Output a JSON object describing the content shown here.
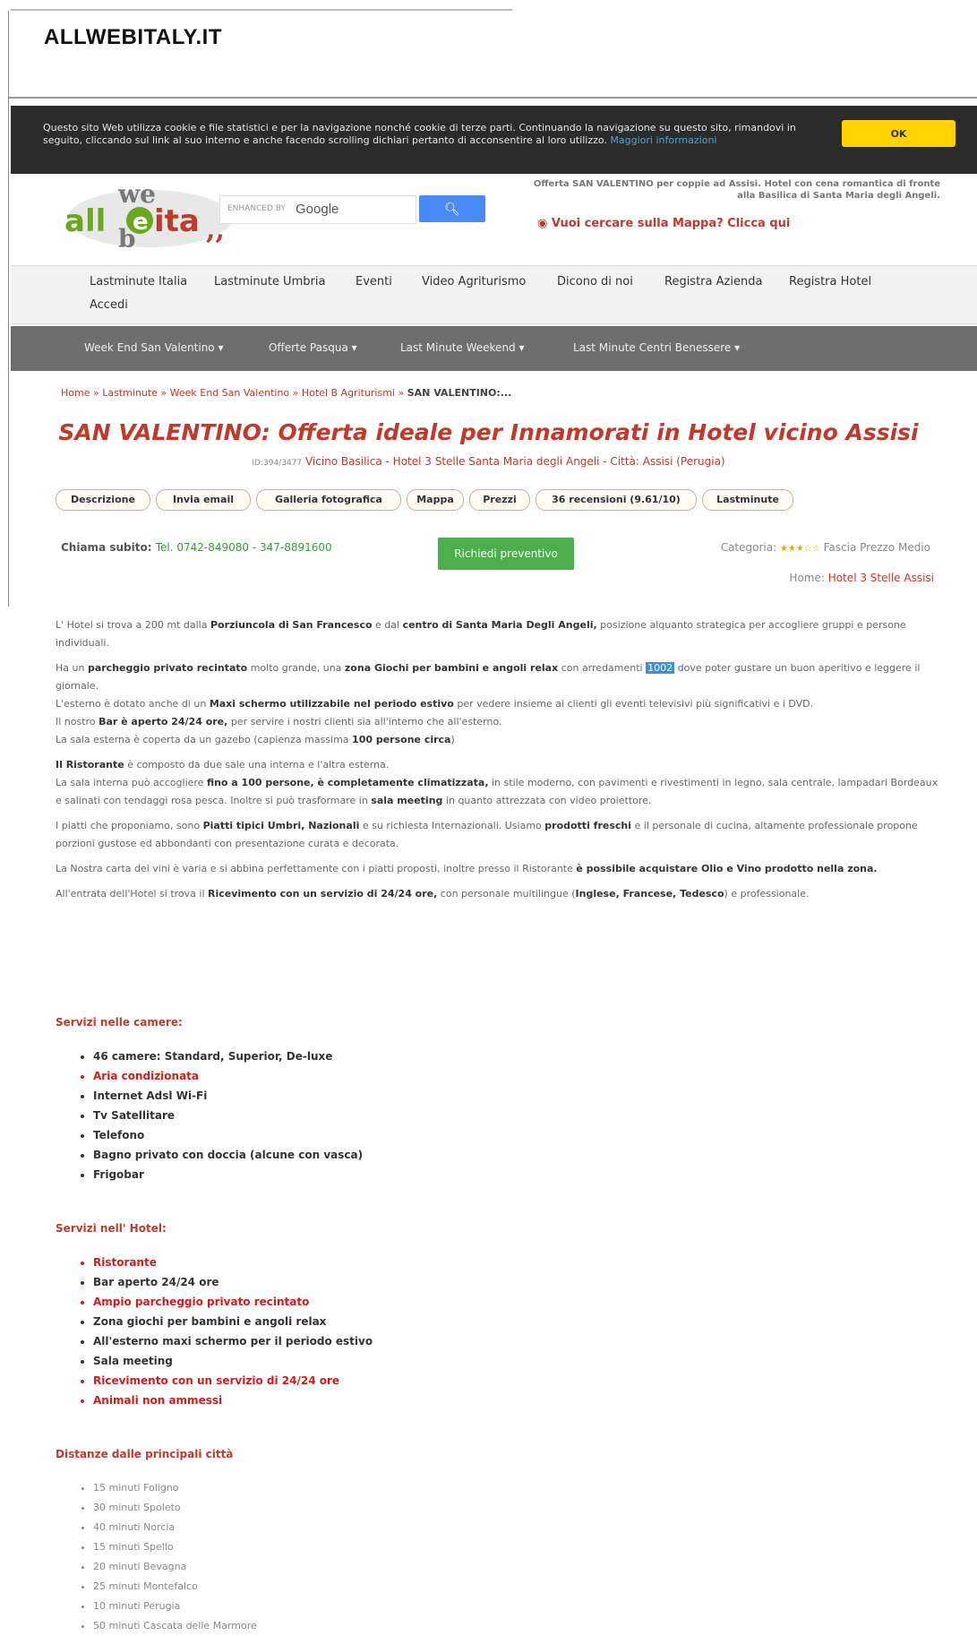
{
  "site": {
    "title": "ALLWEBITALY.IT"
  },
  "cookie": {
    "message": "Questo sito Web utilizza cookie e file statistici e per la navigazione nonché cookie di terze parti. Continuando la navigazione su questo sito, rimandovi in seguito, cliccando sul link al suo interno e anche facendo scrolling dichiari pertanto di acconsentire al loro utilizzo.",
    "link": "Maggiori informazioni",
    "ok_label": "OK"
  },
  "logo": {
    "text": "allweita"
  },
  "search": {
    "label": "ENHANCED BY",
    "brand": "Google",
    "icon": "search-icon"
  },
  "promo": "Offerta SAN VALENTINO per coppie ad Assisi. Hotel con cena romantica di fronte alla Basilica di Santa Maria degli Angeli.",
  "map_link": "Vuoi cercare sulla Mappa? Clicca qui",
  "nav_top": [
    "Lastminute Italia",
    "Lastminute Umbria",
    "Eventi",
    "Video Agriturismo",
    "Dicono di noi",
    "Registra Azienda",
    "Registra Hotel",
    "Accedi"
  ],
  "nav_bottom": [
    "Week End San Valentino ▾",
    "Offerte Pasqua ▾",
    "Last Minute Weekend ▾",
    "Last Minute Centri Benessere ▾"
  ],
  "breadcrumb": {
    "items": "Home » Lastminute » Week End San Valentino » Hotel B Agriturismi » ",
    "current": "SAN VALENTINO:..."
  },
  "heading": "SAN VALENTINO: Offerta ideale per Innamorati in Hotel vicino Assisi",
  "subline": {
    "id": "ID:394/3477",
    "text": "Vicino Basilica - Hotel 3 Stelle Santa Maria degli Angeli - Città: Assisi (Perugia)"
  },
  "tabs": [
    "Descrizione",
    "Invia email",
    "Galleria fotografica",
    "Mappa",
    "Prezzi",
    "36 recensioni (9.61/10)",
    "Lastminute"
  ],
  "contact": {
    "label": "Chiama subito:",
    "phone": "Tel. 0742-849080 - 347-8891600"
  },
  "quote_button": "Richiedi preventivo",
  "category": {
    "label": "Categoria:",
    "stars": "★★★☆☆",
    "band": "Fascia Prezzo Medio"
  },
  "home_link": {
    "label": "Home:",
    "link": "Hotel 3 Stelle Assisi"
  },
  "description": {
    "p1a": "L' Hotel si trova a 200 mt dalla ",
    "p1b": "Porziuncola di San Francesco",
    "p1c": " e dal ",
    "p1d": "centro di Santa Maria Degli Angeli,",
    "p1e": " posizione alquanto strategica per accogliere gruppi e persone individuali.",
    "p2a": "Ha un ",
    "p2b": "parcheggio privato recintato",
    "p2c": " molto grande, una ",
    "p2d": "zona Giochi per bambini e angoli relax",
    "p2e": " con arredamenti ",
    "p2hl": "1002",
    "p2f": " dove poter gustare un buon aperitivo e leggere il giornale.",
    "p3a": "L'esterno è dotato anche di un ",
    "p3b": "Maxi schermo utilizzabile nel periodo estivo",
    "p3c": " per vedere insieme ai clienti gli eventi  televisivi più significativi e i DVD.",
    "p3d": "Il nostro ",
    "p3e": "Bar è aperto 24/24 ore,",
    "p3f": " per servire i nostri clienti sia all'interno che all'esterno.",
    "p3g": "La sala esterna è coperta da un gazebo (capienza massima ",
    "p3h": "100 persone circa",
    "p3i": ")",
    "p4a": "Il Ristorante",
    "p4b": " è composto da due sale una interna e l'altra esterna.",
    "p4c": "La sala interna può accogliere ",
    "p4d": "fino a 100 persone, è completamente climatizzata,",
    "p4e": "  in stile moderno, con pavimenti e rivestimenti in legno, sala centrale, lampadari Bordeaux e salinati con tendaggi rosa pesca. Inoltre si può trasformare in ",
    "p4f": "sala meeting",
    "p4g": " in quanto attrezzata con video proiettore.",
    "p5a": "I piatti che proponiamo, sono ",
    "p5b": "Piatti tipici Umbri, Nazionali",
    "p5c": " e su richiesta Internazionali. Usiamo ",
    "p5d": "prodotti freschi",
    "p5e": " e il personale di cucina, altamente professionale propone porzioni gustose ed abbondanti con presentazione curata e decorata.",
    "p6a": "La Nostra carta dei vini è varia e si abbina perfettamente con i piatti proposti, inoltre presso il Ristorante ",
    "p6b": "è possibile acquistare Olio e Vino prodotto nella zona.",
    "p7a": "All'entrata dell'Hotel si trova il ",
    "p7b": "Ricevimento con un servizio di 24/24 ore,",
    "p7c": " con personale multilingue (",
    "p7d": "Inglese, Francese, Tedesco",
    "p7e": ") e professionale."
  },
  "rooms": {
    "heading": "Servizi nelle camere:",
    "items": [
      {
        "t": "46 camere: Standard, Superior, De-luxe",
        "red": false
      },
      {
        "t": "Aria condizionata",
        "red": true
      },
      {
        "t": "Internet Adsl Wi-Fi",
        "red": false
      },
      {
        "t": "Tv Satellitare",
        "red": false
      },
      {
        "t": "Telefono",
        "red": false
      },
      {
        "t": "Bagno privato con doccia (alcune con vasca)",
        "red": false
      },
      {
        "t": "Frigobar",
        "red": false
      }
    ]
  },
  "hotel": {
    "heading": "Servizi nell' Hotel:",
    "items": [
      {
        "t": "Ristorante",
        "red": true
      },
      {
        "t": "Bar aperto 24/24 ore",
        "red": false
      },
      {
        "t": "Ampio parcheggio privato recintato",
        "red": true
      },
      {
        "t": "Zona giochi per bambini e angoli relax",
        "red": false
      },
      {
        "t": "All'esterno maxi schermo per il periodo estivo",
        "red": false
      },
      {
        "t": "Sala meeting",
        "red": false
      },
      {
        "t": "Ricevimento con un servizio di 24/24 ore",
        "red": true
      },
      {
        "t": "Animali non ammessi",
        "red": true
      }
    ]
  },
  "distances": {
    "heading": "Distanze dalle principali città",
    "items": [
      "15 minuti Foligno",
      "30 minuti Spoleto",
      "40 minuti Norcia",
      "15 minuti Spello",
      "20 minuti Bevagna",
      "25 minuti Montefalco",
      "10 minuti Perugia",
      "50 minuti Cascata delle Marmore"
    ]
  }
}
